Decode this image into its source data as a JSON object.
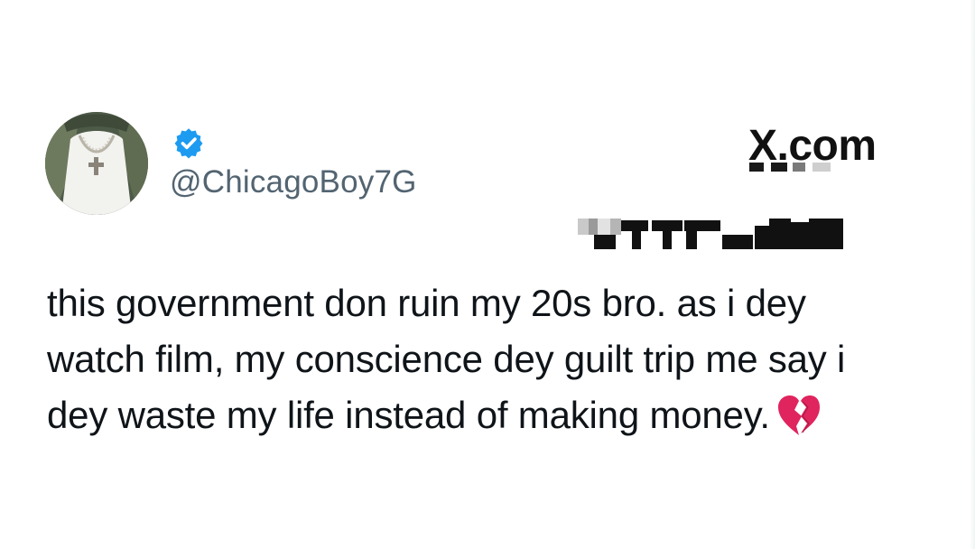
{
  "tweet": {
    "handle": "@ChicagoBoy7G",
    "verified": true,
    "text_lines": [
      "this government don ruin my 20s bro. as i dey",
      "watch film, my conscience dey guilt trip me say i",
      "dey waste my life instead of making money."
    ],
    "emoji": "broken-heart-icon"
  },
  "brand": {
    "label": "X.com"
  },
  "colors": {
    "verified_badge": "#1d9bf0",
    "handle_text": "#536471",
    "body_text": "#0f1419",
    "broken_heart": "#e0245e"
  }
}
